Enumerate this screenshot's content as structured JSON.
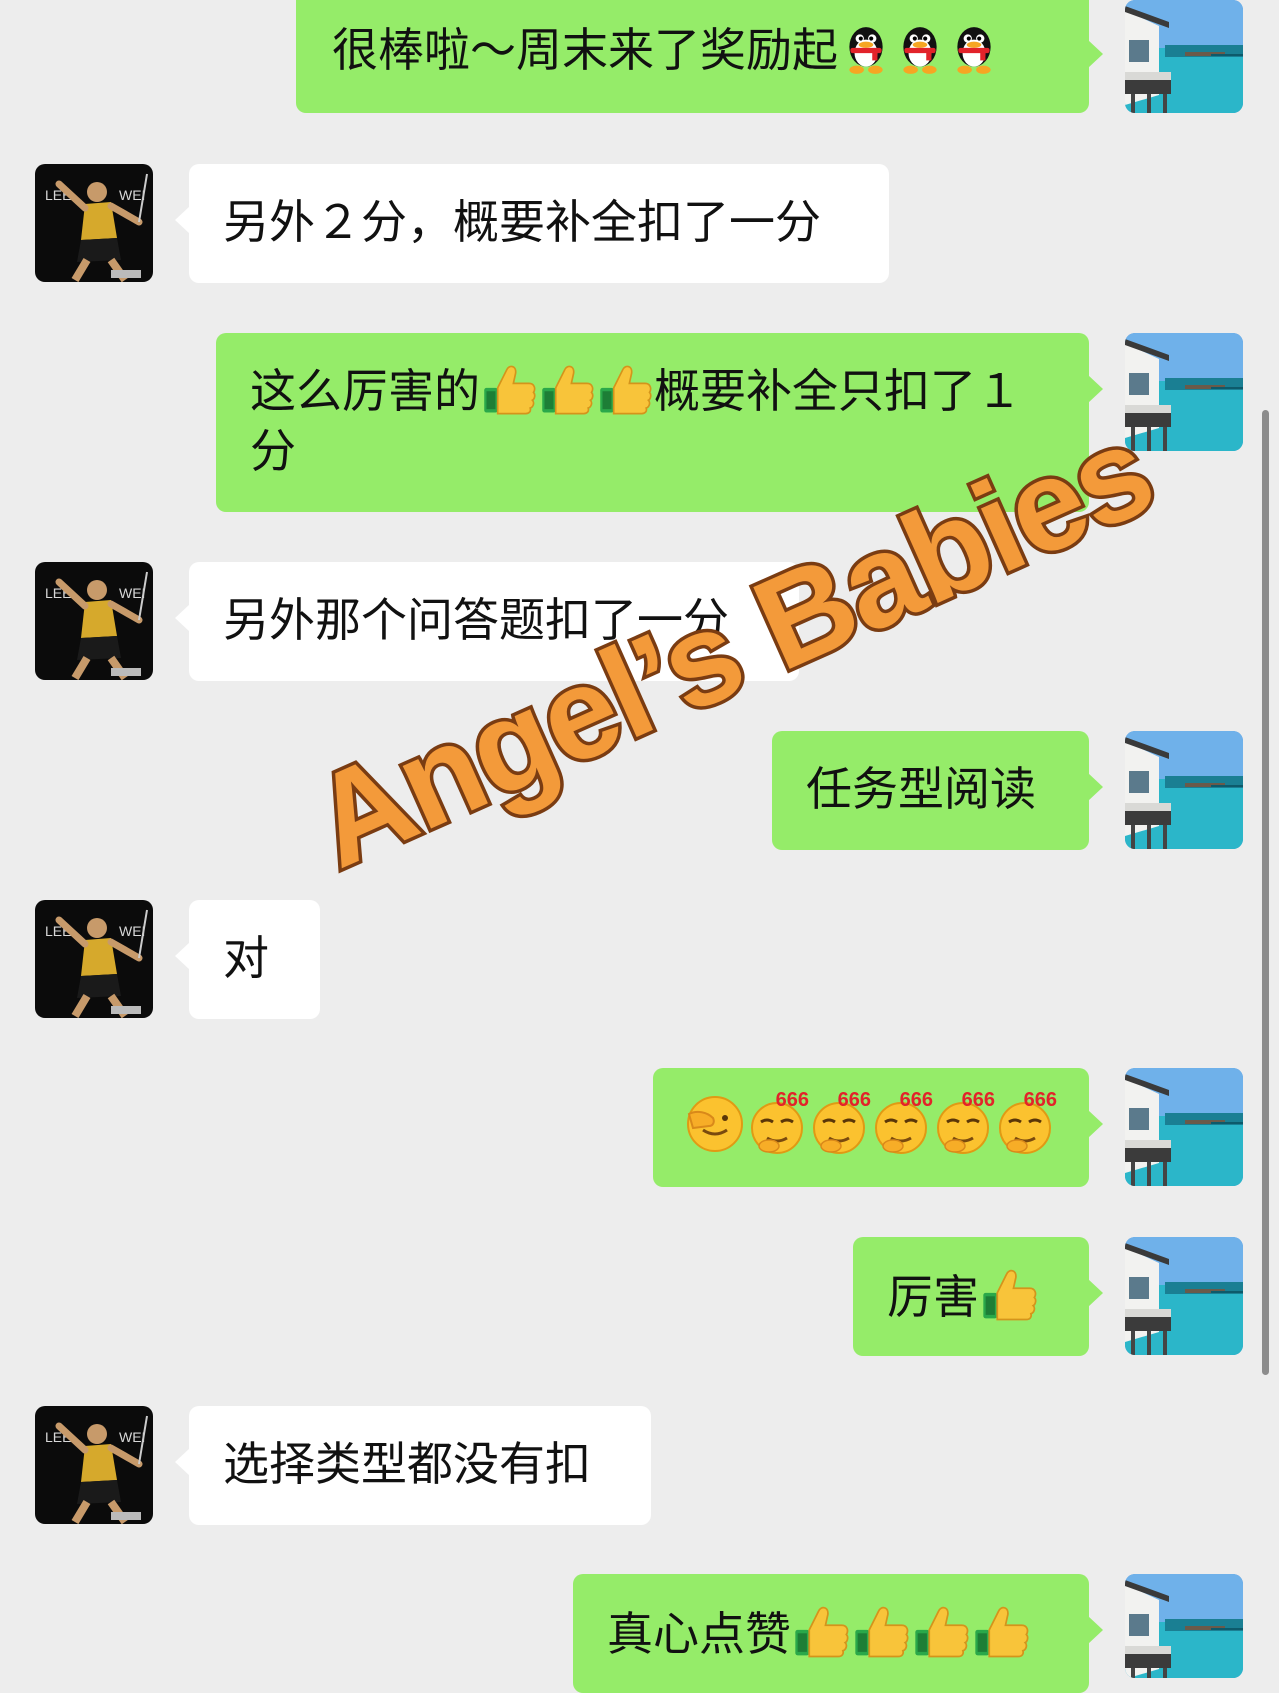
{
  "conversation": {
    "messages": [
      {
        "side": "right",
        "text": "很棒啦～周末来了奖励起",
        "emojis": [
          "penguin-icon",
          "penguin-icon",
          "penguin-icon"
        ]
      },
      {
        "side": "left",
        "text": "另外２分，概要补全扣了一分"
      },
      {
        "side": "right",
        "text_parts": [
          "这么厉害的",
          "概要补全只扣了１分"
        ],
        "emojis": [
          "thumbs-up-icon",
          "thumbs-up-icon",
          "thumbs-up-icon"
        ]
      },
      {
        "side": "left",
        "text": "另外那个问答题扣了一分"
      },
      {
        "side": "right",
        "text": "任务型阅读"
      },
      {
        "side": "left",
        "text": "对"
      },
      {
        "side": "right",
        "text": "",
        "emojis": [
          "facepalm-icon",
          "666-icon",
          "666-icon",
          "666-icon",
          "666-icon",
          "666-icon"
        ],
        "emoji_label": "666"
      },
      {
        "side": "right",
        "text": "厉害",
        "emojis": [
          "thumbs-up-icon"
        ]
      },
      {
        "side": "left",
        "text": "选择类型都没有扣"
      },
      {
        "side": "right",
        "text": "真心点赞",
        "emojis": [
          "thumbs-up-icon",
          "thumbs-up-icon",
          "thumbs-up-icon",
          "thumbs-up-icon"
        ]
      }
    ]
  },
  "avatars": {
    "left_text_1": "LEE",
    "left_text_2": "WEI"
  },
  "watermark": {
    "text": "Angel’s Babies"
  },
  "colors": {
    "background": "#ededed",
    "own_bubble": "#95ec69",
    "other_bubble": "#ffffff",
    "watermark_fill": "#f39a3a",
    "watermark_stroke": "#7a3c12"
  }
}
